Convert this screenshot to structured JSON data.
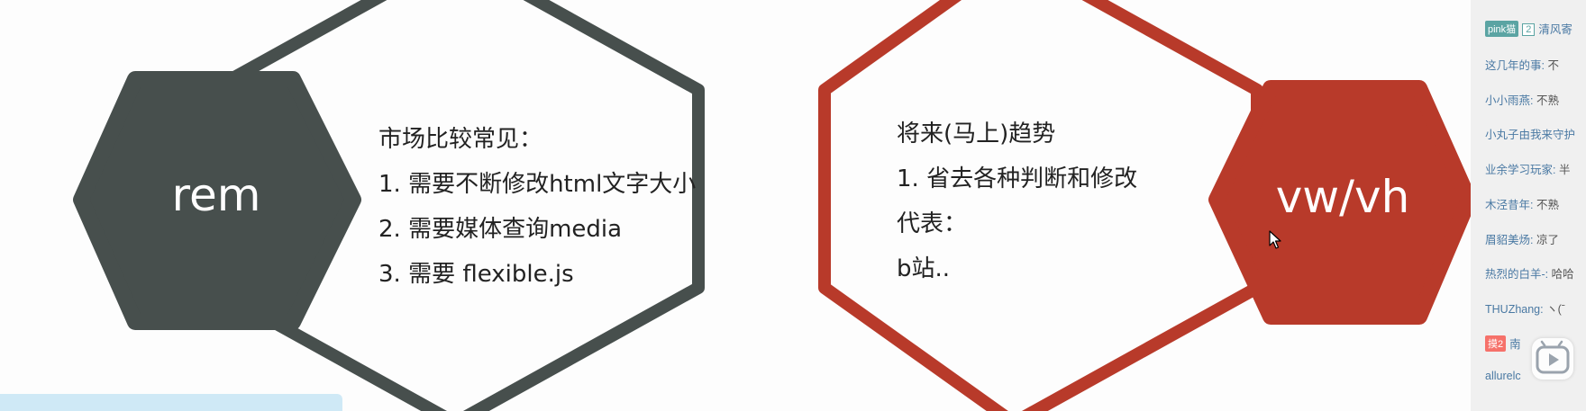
{
  "slide": {
    "left_hex_title": "rem",
    "right_hex_title": "vw/vh",
    "left_panel_lines": [
      "市场比较常见：",
      "1. 需要不断修改html文字大小",
      "2. 需要媒体查询media",
      "3. 需要 flexible.js"
    ],
    "right_panel_lines": [
      "将来(马上)趋势",
      "1. 省去各种判断和修改",
      "代表：",
      "b站.."
    ],
    "colors": {
      "left_accent": "#474f4d",
      "right_accent": "#b83a2a",
      "background": "#fdfdfd"
    }
  },
  "danmaku": {
    "rows": [
      {
        "badge": "pink猫",
        "level": "2",
        "user": "清风寄",
        "text": ""
      },
      {
        "user": "这几年的事:",
        "text": " 不"
      },
      {
        "user": "小小雨燕:",
        "text": " 不熟"
      },
      {
        "user": "小丸子由我来守护",
        "text": ""
      },
      {
        "user": "业余学习玩家:",
        "text": " 半"
      },
      {
        "user": "木泾昔年:",
        "text": " 不熟"
      },
      {
        "user": "眉貂美炀:",
        "text": " 凉了"
      },
      {
        "user": "热烈的白羊-:",
        "text": " 哈哈"
      },
      {
        "user": "THUZhang:",
        "text": " ヽ(ˉ"
      },
      {
        "badge_fan": "摸2",
        "user": "南",
        "text": ""
      },
      {
        "user": "allurelc",
        "text": ""
      }
    ],
    "colors": {
      "panel": "#f0f0f0",
      "username": "#4a79a3",
      "badge": "#5ba4a3"
    }
  },
  "icons": {
    "play": "play-icon",
    "cursor": "mouse-cursor-icon"
  }
}
